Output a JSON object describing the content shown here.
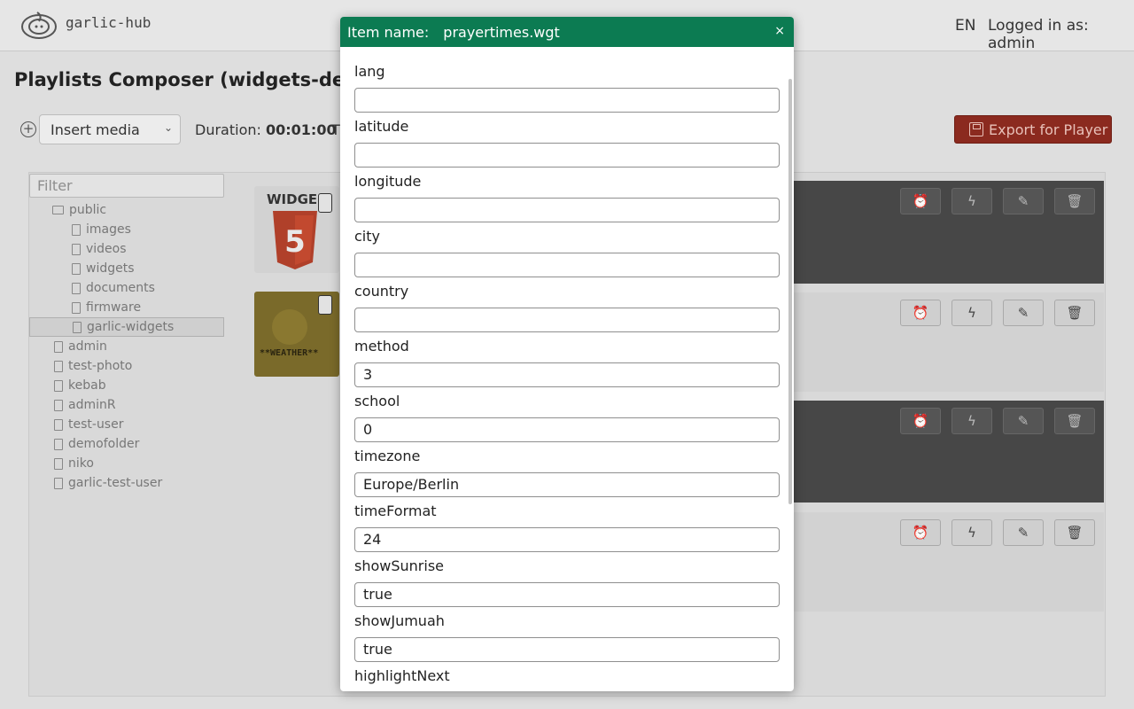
{
  "header": {
    "logo_text": "garlic-hub",
    "lang": "EN",
    "login": "Logged in as: admin"
  },
  "page": {
    "title": "Playlists Composer (widgets-demo)"
  },
  "toolbar": {
    "insert_media": "Insert media",
    "duration_label": "Duration:",
    "duration_value": "00:01:00",
    "truncated_label": "T",
    "export_label": "Export for Player"
  },
  "sidebar": {
    "filter_placeholder": "Filter",
    "tree": [
      {
        "label": "public",
        "type": "folder",
        "level": 1
      },
      {
        "label": "images",
        "type": "file",
        "level": 2
      },
      {
        "label": "videos",
        "type": "file",
        "level": 2
      },
      {
        "label": "widgets",
        "type": "file",
        "level": 2
      },
      {
        "label": "documents",
        "type": "file",
        "level": 2
      },
      {
        "label": "firmware",
        "type": "file",
        "level": 2
      },
      {
        "label": "garlic-widgets",
        "type": "file",
        "level": 2,
        "selected": true
      },
      {
        "label": "admin",
        "type": "file",
        "level": 1
      },
      {
        "label": "test-photo",
        "type": "file",
        "level": 1
      },
      {
        "label": "kebab",
        "type": "file",
        "level": 1
      },
      {
        "label": "adminR",
        "type": "file",
        "level": 1
      },
      {
        "label": "test-user",
        "type": "file",
        "level": 1
      },
      {
        "label": "demofolder",
        "type": "file",
        "level": 1
      },
      {
        "label": "niko",
        "type": "file",
        "level": 1
      },
      {
        "label": "garlic-test-user",
        "type": "file",
        "level": 1
      }
    ]
  },
  "media": {
    "thumb1_text": "WIDGE",
    "thumb2_text": "**WEATHER**"
  },
  "row_actions": {
    "icons": [
      "alarm-clock-icon",
      "lightning-icon",
      "pencil-icon",
      "trash-icon"
    ],
    "glyphs": [
      "⏰",
      "ϟ",
      "✎",
      "🗑"
    ],
    "rows": [
      "dark",
      "light",
      "dark",
      "light"
    ]
  },
  "modal": {
    "title_label": "Item name:",
    "title_value": "prayertimes.wgt",
    "close_label": "×",
    "header_color": "#0c7b52",
    "fields": [
      {
        "label": "lang",
        "value": ""
      },
      {
        "label": "latitude",
        "value": ""
      },
      {
        "label": "longitude",
        "value": ""
      },
      {
        "label": "city",
        "value": ""
      },
      {
        "label": "country",
        "value": ""
      },
      {
        "label": "method",
        "value": "3"
      },
      {
        "label": "school",
        "value": "0"
      },
      {
        "label": "timezone",
        "value": "Europe/Berlin"
      },
      {
        "label": "timeFormat",
        "value": "24"
      },
      {
        "label": "showSunrise",
        "value": "true"
      },
      {
        "label": "showJumuah",
        "value": "true"
      },
      {
        "label": "highlightNext",
        "value": ""
      }
    ]
  },
  "colors": {
    "accent": "#0c7b52",
    "export": "#8b2a1f"
  }
}
